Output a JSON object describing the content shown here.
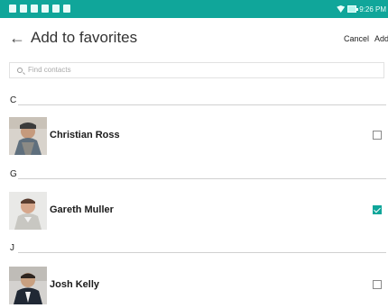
{
  "status_bar": {
    "time": "9:26 PM",
    "icons": [
      "notification-icon",
      "notification-icon",
      "notification-icon",
      "notification-icon",
      "notification-icon",
      "notification-icon"
    ]
  },
  "header": {
    "title": "Add to favorites",
    "cancel_label": "Cancel",
    "add_label": "Add",
    "back_icon": "back-arrow-icon"
  },
  "search": {
    "placeholder": "Find contacts"
  },
  "sections": [
    {
      "letter": "C",
      "contacts": [
        {
          "name": "Christian Ross",
          "checked": false
        }
      ]
    },
    {
      "letter": "G",
      "contacts": [
        {
          "name": "Gareth Muller",
          "checked": true
        }
      ]
    },
    {
      "letter": "J",
      "contacts": [
        {
          "name": "Josh Kelly",
          "checked": false
        }
      ]
    }
  ],
  "colors": {
    "accent": "#10a69a",
    "status_bar": "#10a69a"
  }
}
